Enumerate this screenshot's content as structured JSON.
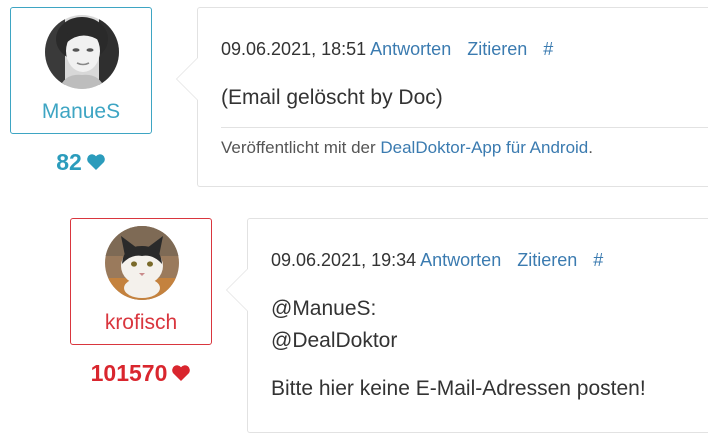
{
  "posts": [
    {
      "user": {
        "name": "ManueS",
        "score": "82",
        "heart_color": "#2b9cbc",
        "avatar_icon": "woman-portrait-avatar"
      },
      "timestamp": "09.06.2021, 18:51",
      "reply_label": "Antworten",
      "quote_label": "Zitieren",
      "permalink_label": "#",
      "content": [
        "(Email gelöscht by Doc)"
      ],
      "footer": {
        "prefix": "Veröffentlicht mit der ",
        "link_text": "DealDoktor-App für Android",
        "suffix": "."
      }
    },
    {
      "user": {
        "name": "krofisch",
        "score": "101570",
        "heart_color": "#d9262e",
        "avatar_icon": "cat-avatar"
      },
      "timestamp": "09.06.2021, 19:34",
      "reply_label": "Antworten",
      "quote_label": "Zitieren",
      "permalink_label": "#",
      "content": [
        "@ManueS:",
        "@DealDoktor",
        "Bitte hier keine E-Mail-Adressen posten!"
      ]
    }
  ]
}
